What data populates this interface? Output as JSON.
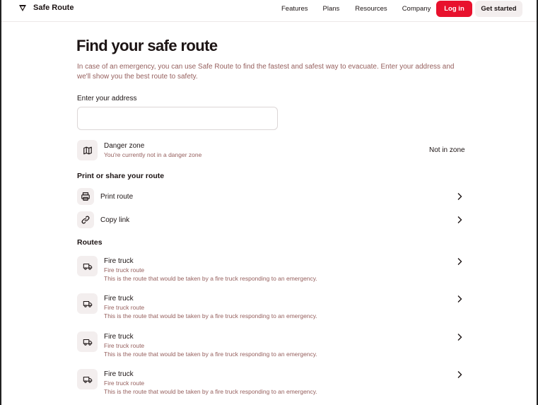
{
  "header": {
    "brand": "Safe Route",
    "nav": [
      "Features",
      "Plans",
      "Resources",
      "Company"
    ],
    "login_label": "Log in",
    "start_label": "Get started"
  },
  "main": {
    "title": "Find your safe route",
    "intro": "In case of an emergency, you can use Safe Route to find the fastest and safest way to evacuate. Enter your address and we'll show you the best route to safety.",
    "address_label": "Enter your address",
    "address_value": "",
    "danger": {
      "title": "Danger zone",
      "subtitle": "You're currently not in a danger zone",
      "status": "Not in zone"
    },
    "share_heading": "Print or share your route",
    "print_label": "Print route",
    "copy_label": "Copy link",
    "routes_heading": "Routes",
    "routes": [
      {
        "title": "Fire truck",
        "subtitle": "Fire truck route",
        "description": "This is the route that would be taken by a fire truck responding to an emergency."
      },
      {
        "title": "Fire truck",
        "subtitle": "Fire truck route",
        "description": "This is the route that would be taken by a fire truck responding to an emergency."
      },
      {
        "title": "Fire truck",
        "subtitle": "Fire truck route",
        "description": "This is the route that would be taken by a fire truck responding to an emergency."
      },
      {
        "title": "Fire truck",
        "subtitle": "Fire truck route",
        "description": "This is the route that would be taken by a fire truck responding to an emergency."
      }
    ]
  },
  "colors": {
    "accent": "#e8112d",
    "muted_text": "#96605e",
    "icon_bg": "#f3eeee"
  }
}
